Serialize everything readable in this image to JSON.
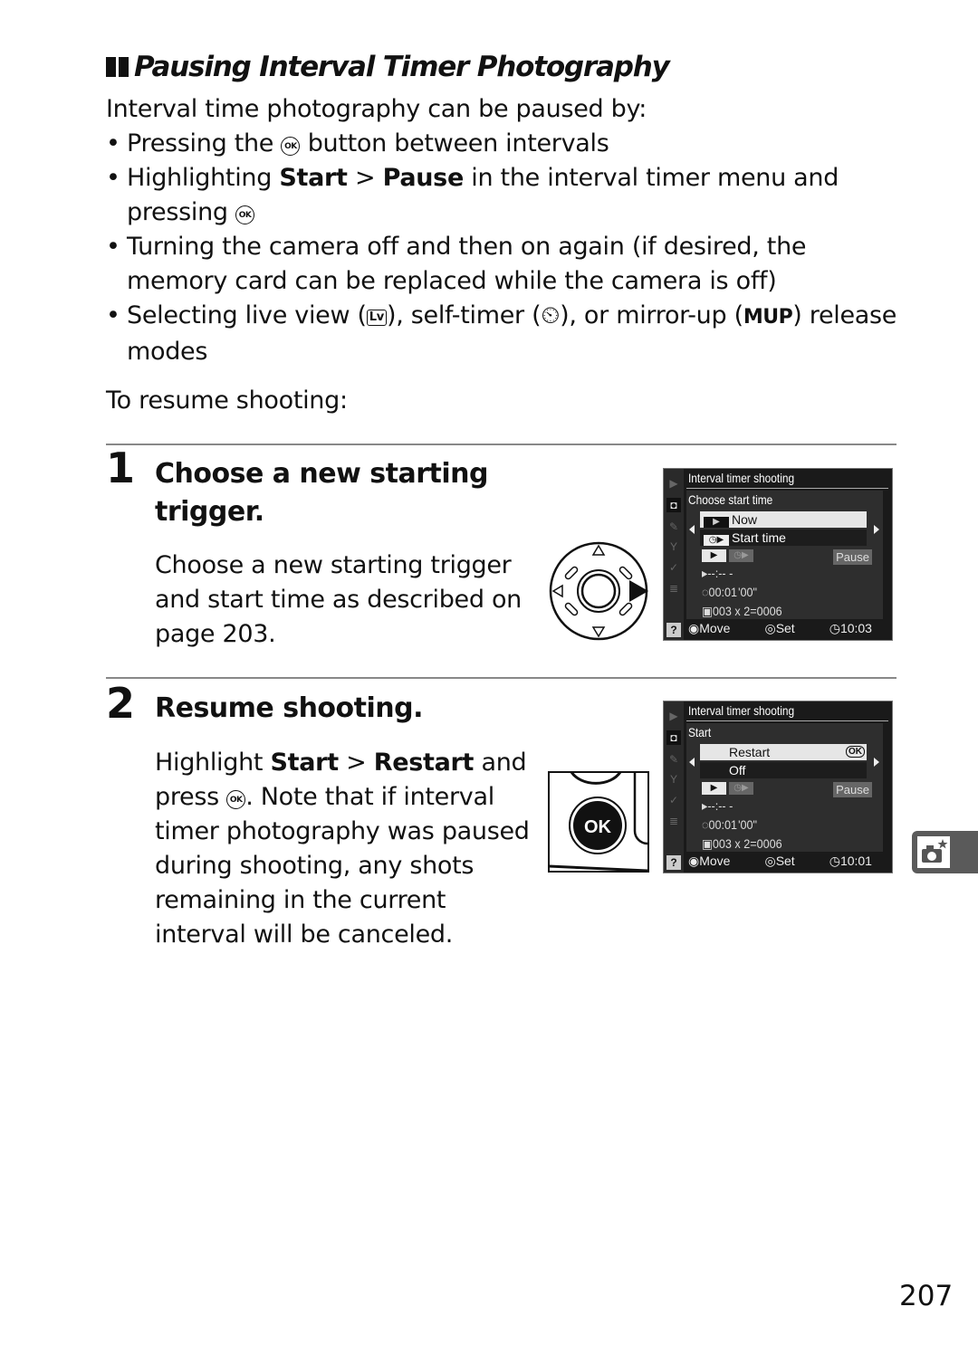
{
  "section": {
    "title": "Pausing Interval Timer Photography",
    "intro": "Interval time photography can be paused by:",
    "bullets": {
      "b1_pre": "Pressing the",
      "b1_post": "button between intervals",
      "b2_pre": "Highlighting",
      "b2_start": "Start",
      "b2_gt": ">",
      "b2_pause": "Pause",
      "b2_post": "in the interval timer menu and pressing",
      "b3": "Turning the camera off and then on again (if desired, the memory card can be replaced while the camera is off)",
      "b4_pre": "Selecting live view (",
      "b4_lv": "Lv",
      "b4_mid1": "), self-timer (",
      "b4_timer": "⏲",
      "b4_mid2": "), or mirror-up (",
      "b4_mup": "MUP",
      "b4_post": ") release modes"
    },
    "resume_intro": "To resume shooting:"
  },
  "ok_symbol": "OK",
  "steps": [
    {
      "number": "1",
      "heading_line1": "Choose a new starting",
      "heading_line2": "trigger.",
      "body": "Choose a new starting trigger and start time as described on page 203.",
      "lcd": {
        "title": "Interval timer shooting",
        "subtitle": "Choose start time",
        "option_selected": "Now",
        "option_other": "Start time",
        "pause": "Pause",
        "start_time": "--:-- -",
        "interval": "00:01 '00\"",
        "shots": "003 x 2=0006",
        "footer_move": "Move",
        "footer_set": "Set",
        "footer_time": "10:03"
      }
    },
    {
      "number": "2",
      "heading_line1": "Resume shooting.",
      "body_pre": "Highlight",
      "body_start": "Start",
      "body_gt": ">",
      "body_restart": "Restart",
      "body_and": "and press",
      "body_post": ". Note that if interval timer photography was paused during shooting, any shots remaining in the current interval will be canceled.",
      "lcd": {
        "title": "Interval timer shooting",
        "subtitle": "Start",
        "option_selected": "Restart",
        "option_selected_badge": "OK",
        "option_other": "Off",
        "pause": "Pause",
        "start_time": "--:-- -",
        "interval": "00:01 '00\"",
        "shots": "003 x 2=0006",
        "footer_move": "Move",
        "footer_set": "Set",
        "footer_time": "10:01"
      }
    }
  ],
  "button_ok_label": "OK",
  "page_number": "207"
}
